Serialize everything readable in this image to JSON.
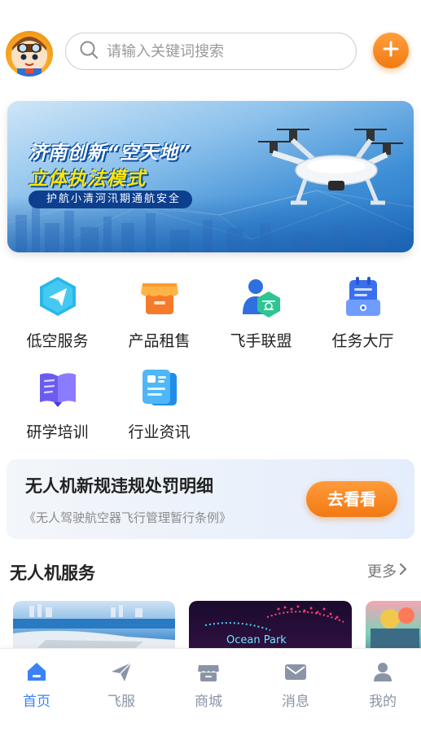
{
  "header": {
    "search_placeholder": "请输入关键词搜索"
  },
  "banner": {
    "title_line1": "济南创新“空天地”",
    "title_line2": "立体执法模式",
    "subtitle": "护航小清河汛期通航安全"
  },
  "services": [
    {
      "label": "低空服务",
      "icon": "paper-plane-icon"
    },
    {
      "label": "产品租售",
      "icon": "storefront-icon"
    },
    {
      "label": "飞手联盟",
      "icon": "pilot-drone-icon"
    },
    {
      "label": "任务大厅",
      "icon": "clipboard-task-icon"
    },
    {
      "label": "研学培训",
      "icon": "open-book-icon"
    },
    {
      "label": "行业资讯",
      "icon": "news-document-icon"
    }
  ],
  "notice": {
    "title": "无人机新规违规处罚明细",
    "subtitle": "《无人驾驶航空器飞行管理暂行条例》",
    "button_label": "去看看"
  },
  "section": {
    "title": "无人机服务",
    "more_label": "更多"
  },
  "cards": [
    {
      "caption": ""
    },
    {
      "caption": "Ocean Park"
    },
    {
      "caption": ""
    }
  ],
  "tabbar": {
    "items": [
      {
        "label": "首页",
        "icon": "home-icon",
        "active": true
      },
      {
        "label": "飞服",
        "icon": "send-icon",
        "active": false
      },
      {
        "label": "商城",
        "icon": "shop-icon",
        "active": false
      },
      {
        "label": "消息",
        "icon": "mail-icon",
        "active": false
      },
      {
        "label": "我的",
        "icon": "user-icon",
        "active": false
      }
    ]
  },
  "colors": {
    "accent_orange": "#f27a12",
    "tab_active": "#3b82f6",
    "tab_inactive": "#8a94a6"
  }
}
